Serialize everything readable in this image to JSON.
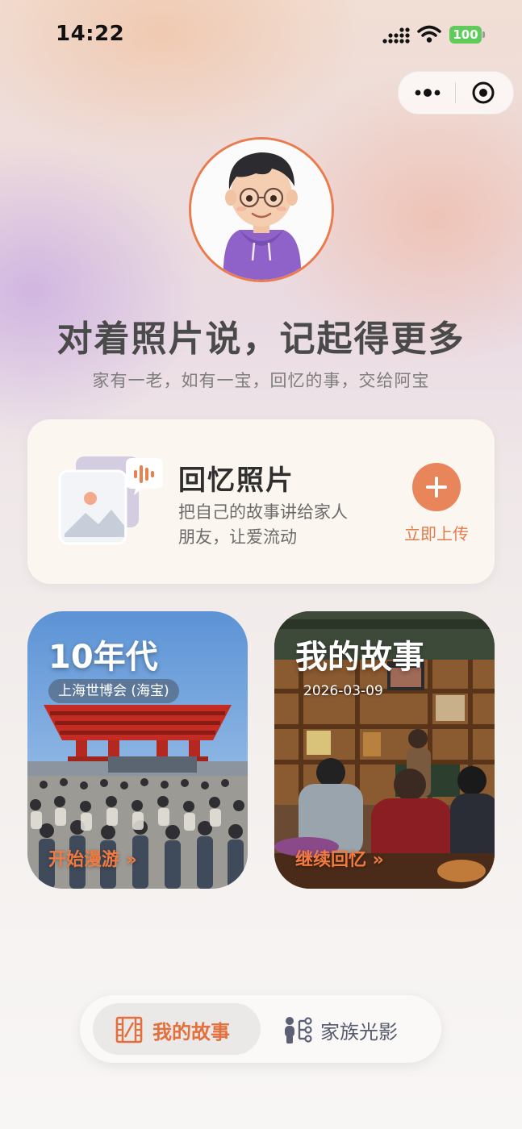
{
  "status_bar": {
    "time": "14:22",
    "battery": "100",
    "icons": [
      "signal-icon",
      "wifi-icon",
      "battery-icon"
    ]
  },
  "capsule": {
    "icons": [
      "more-icon",
      "close-target-icon"
    ]
  },
  "hero": {
    "headline": "对着照片说，记起得更多",
    "subline": "家有一老，如有一宝，回忆的事，交给阿宝"
  },
  "upload_card": {
    "title": "回忆照片",
    "description_line1": "把自己的故事讲给家人",
    "description_line2": "朋友，让爱流动",
    "button_label": "立即上传"
  },
  "stories": [
    {
      "title": "10年代",
      "tag": "上海世博会 (海宝)",
      "action": "开始漫游 »"
    },
    {
      "title": "我的故事",
      "date": "2026-03-09",
      "action": "继续回忆 »"
    }
  ],
  "tabbar": {
    "tabs": [
      {
        "label": "我的故事",
        "active": true
      },
      {
        "label": "家族光影",
        "active": false
      }
    ]
  },
  "colors": {
    "accent": "#e9855a",
    "active_tab_text": "#e36f3c"
  }
}
